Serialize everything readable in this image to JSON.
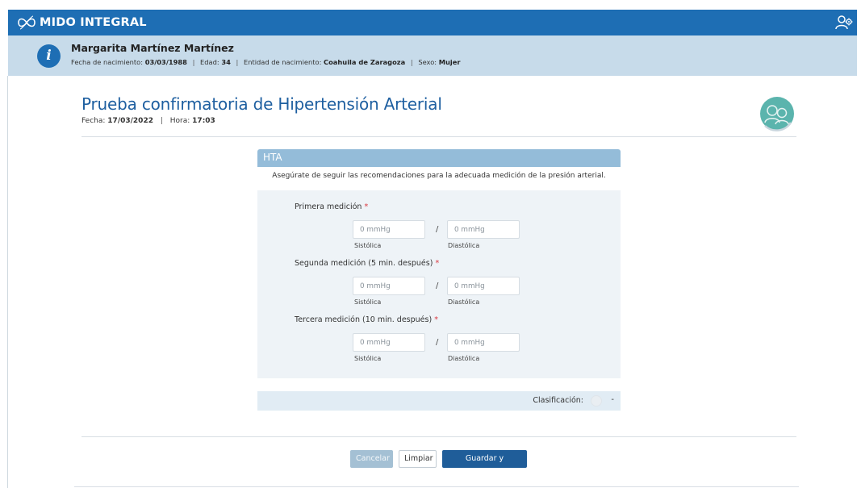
{
  "app": {
    "brand": "MIDO INTEGRAL",
    "brand_icon": "infinity-logo-icon",
    "user_icon": "user-settings-icon",
    "colors": {
      "topbar": "#1e6eb4",
      "patient_bar": "#c7dbea",
      "title": "#1e5fa0",
      "card_head": "#94bcd9",
      "primary_button": "#1f5d99",
      "required": "#d9363e"
    }
  },
  "patient": {
    "name": "Margarita Martínez Martínez",
    "birth_label": "Fecha de nacimiento:",
    "birth_value": "03/03/1988",
    "age_label": "Edad:",
    "age_value": "34",
    "entity_label": "Entidad de nacimiento:",
    "entity_value": "Coahuila de Zaragoza",
    "sex_label": "Sexo:",
    "sex_value": "Mujer",
    "info_icon": "info-icon"
  },
  "page": {
    "title": "Prueba confirmatoria de Hipertensión Arterial",
    "date_label": "Fecha:",
    "date_value": "17/03/2022",
    "time_label": "Hora:",
    "time_value": "17:03",
    "avatar_icon": "patient-avatar-icon"
  },
  "form": {
    "section_title": "HTA",
    "note": "Asegúrate de seguir las recomendaciones para la adecuada medición de la presión arterial.",
    "measurements": [
      {
        "label": "Primera medición",
        "systolic_placeholder": "0 mmHg",
        "diastolic_placeholder": "0 mmHg",
        "systolic_label": "Sistólica",
        "diastolic_label": "Diastólica"
      },
      {
        "label": "Segunda medición (5 min. después)",
        "systolic_placeholder": "0 mmHg",
        "diastolic_placeholder": "0 mmHg",
        "systolic_label": "Sistólica",
        "diastolic_label": "Diastólica"
      },
      {
        "label": "Tercera medición (10 min. después)",
        "systolic_placeholder": "0 mmHg",
        "diastolic_placeholder": "0 mmHg",
        "systolic_label": "Sistólica",
        "diastolic_label": "Diastólica"
      }
    ],
    "required_mark": "*",
    "separator": "/",
    "classification_label": "Clasificación:",
    "classification_value": "-"
  },
  "buttons": {
    "cancel": "Cancelar",
    "clear": "Limpiar",
    "save": "Guardar y continuar"
  }
}
